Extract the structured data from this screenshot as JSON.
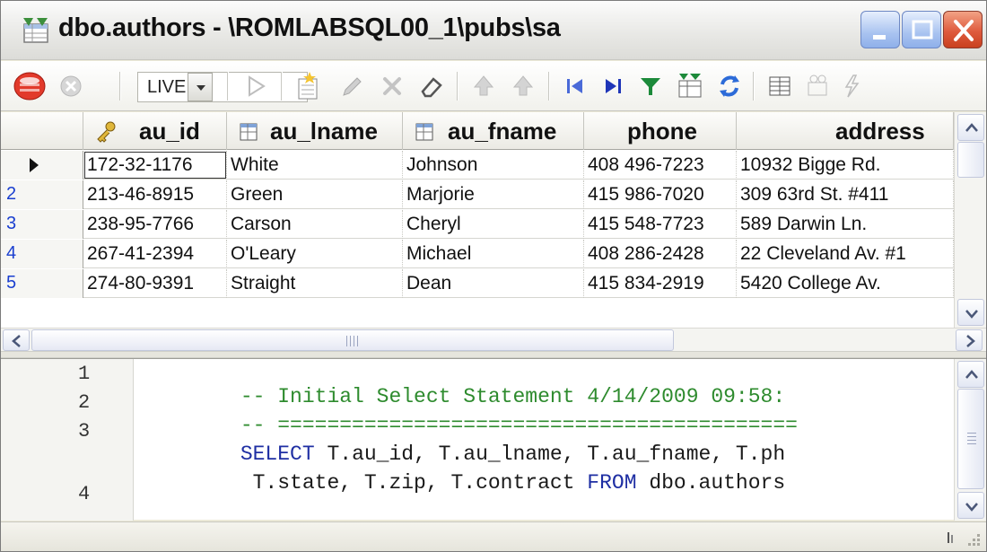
{
  "window": {
    "title": "dbo.authors - \\ROMLABSQL00_1\\pubs\\sa",
    "colors": {
      "titlebar": "#e9e9e6",
      "close_button": "#df5b3e",
      "min_max_buttons": "#a9c3f0"
    }
  },
  "toolbar": {
    "mode_combo_value": "LIVE",
    "icons": [
      "database-icon",
      "stop-icon",
      "play-icon",
      "new-record-icon",
      "edit-icon",
      "delete-icon",
      "eraser-icon",
      "up-arrow-icon",
      "up-arrow-alt-icon",
      "first-record-icon",
      "last-record-icon",
      "filter-icon",
      "table-filter-icon",
      "refresh-icon",
      "grid-view-icon",
      "options-icon",
      "lightning-icon"
    ]
  },
  "grid": {
    "columns": [
      "au_id",
      "au_lname",
      "au_fname",
      "phone",
      "address"
    ],
    "column_icons": [
      "key-icon",
      "column-icon",
      "column-icon",
      "",
      ""
    ],
    "current_row_marker": "row-pointer-icon",
    "rows": [
      {
        "num": "",
        "cells": [
          "172-32-1176",
          "White",
          "Johnson",
          "408 496-7223",
          "10932 Bigge Rd."
        ]
      },
      {
        "num": "2",
        "cells": [
          "213-46-8915",
          "Green",
          "Marjorie",
          "415 986-7020",
          "309 63rd St. #411"
        ]
      },
      {
        "num": "3",
        "cells": [
          "238-95-7766",
          "Carson",
          "Cheryl",
          "415 548-7723",
          "589 Darwin Ln."
        ]
      },
      {
        "num": "4",
        "cells": [
          "267-41-2394",
          "O'Leary",
          "Michael",
          "408 286-2428",
          "22 Cleveland Av. #1"
        ]
      },
      {
        "num": "5",
        "cells": [
          "274-80-9391",
          "Straight",
          "Dean",
          "415 834-2919",
          "5420 College Av."
        ]
      }
    ]
  },
  "editor": {
    "line_numbers": [
      "1",
      "2",
      "3",
      "4"
    ],
    "lines": [
      {
        "segments": [
          {
            "t": "-- Initial Select Statement 4/14/2009 09:58:",
            "c": "comment"
          }
        ]
      },
      {
        "segments": [
          {
            "t": "-- ==========================================",
            "c": "comment"
          }
        ]
      },
      {
        "segments": [
          {
            "t": "SELECT",
            "c": "keyword"
          },
          {
            "t": " T.au_id, T.au_lname, T.au_fname, T.ph",
            "c": "text"
          }
        ]
      },
      {
        "segments": [
          {
            "t": " T.state, T.zip, T.contract ",
            "c": "text"
          },
          {
            "t": "FROM",
            "c": "keyword"
          },
          {
            "t": " dbo.authors",
            "c": "text"
          }
        ]
      }
    ],
    "colors": {
      "comment": "#2e8b2e",
      "keyword": "#1f2fa3"
    }
  }
}
